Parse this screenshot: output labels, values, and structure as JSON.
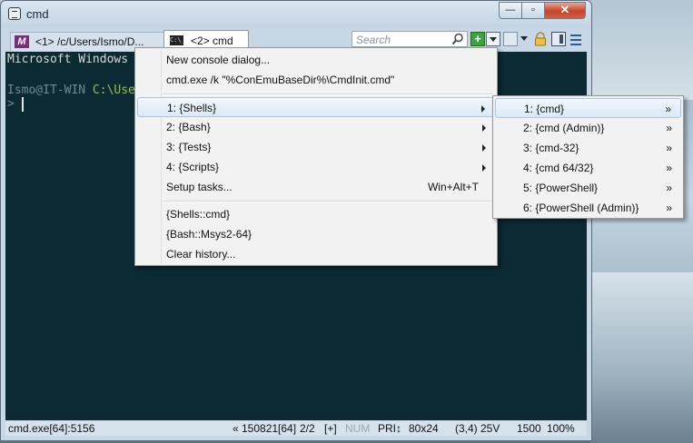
{
  "window": {
    "title": "cmd"
  },
  "tabs": [
    {
      "label": "<1> /c/Users/Ismo/D...",
      "icon": "msys-icon",
      "icon_text": "M"
    },
    {
      "label": "<2> cmd",
      "icon": "console-icon",
      "icon_text": "C:\\_"
    }
  ],
  "toolbar": {
    "search_placeholder": "Search",
    "new_console": "+"
  },
  "console": {
    "line1": "Microsoft Windows",
    "prompt_user": "Ismo@IT-WIN",
    "prompt_path": "C:\\Use",
    "prompt_char": ">"
  },
  "menu": {
    "items": [
      {
        "label": "New console dialog..."
      },
      {
        "label": "cmd.exe /k \"%ConEmuBaseDir%\\CmdInit.cmd\""
      },
      {
        "label": "1: {Shells}",
        "submenu": true
      },
      {
        "label": "2: {Bash}",
        "submenu": true
      },
      {
        "label": "3: {Tests}",
        "submenu": true
      },
      {
        "label": "4: {Scripts}",
        "submenu": true
      },
      {
        "label": "Setup tasks...",
        "shortcut": "Win+Alt+T"
      },
      {
        "label": "{Shells::cmd}"
      },
      {
        "label": "{Bash::Msys2-64}"
      },
      {
        "label": "Clear history..."
      }
    ]
  },
  "submenu": {
    "items": [
      {
        "label": "1: {cmd}",
        "mark": "»"
      },
      {
        "label": "2: {cmd (Admin)}",
        "mark": "»"
      },
      {
        "label": "3: {cmd-32}",
        "mark": "»"
      },
      {
        "label": "4: {cmd 64/32}",
        "mark": "»"
      },
      {
        "label": "5: {PowerShell}",
        "mark": "»"
      },
      {
        "label": "6: {PowerShell (Admin)}",
        "mark": "»"
      }
    ]
  },
  "status": {
    "process": "cmd.exe[64]:5156",
    "version": "« 150821[64]",
    "tabs": "2/2",
    "plus": "[+]",
    "num": "NUM",
    "pri": "PRI↕",
    "size": "80x24",
    "cursor": "(3,4) 25V",
    "buffer": "1500",
    "zoom": "100%"
  }
}
